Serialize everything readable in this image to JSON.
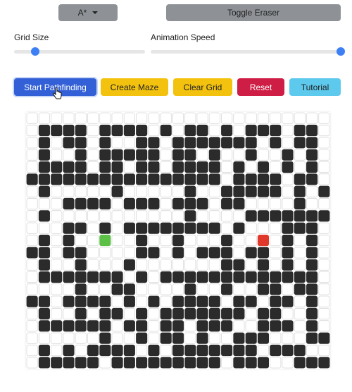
{
  "controls": {
    "algorithm": "A*",
    "toggle_eraser": "Toggle Eraser",
    "grid_size_label": "Grid Size",
    "grid_size_level": 0.16,
    "animation_speed_label": "Animation Speed",
    "animation_speed_level": 1.0
  },
  "actions": {
    "start": "Start Pathfinding",
    "maze": "Create Maze",
    "clear": "Clear Grid",
    "reset": "Reset",
    "tutorial": "Tutorial"
  },
  "grid": {
    "rows": 21,
    "cols": 25,
    "start": [
      10,
      6
    ],
    "end": [
      10,
      19
    ],
    "walls": [
      "0000000000000000000000000",
      "0111101111010110101110110",
      "0101101001101111111010110",
      "0100101111101101001001010",
      "0111101101101111010101010",
      "1111111111111111011110110",
      "0100000100000100111110101",
      "0001111011101110110000100",
      "0100000000000100001111111",
      "0001101011111111010001110",
      "0101000001001000100101010",
      "1101100001101011101101010",
      "0100100010000000110101010",
      "0111111101011111111111110",
      "0000100110000100100110110",
      "1101111010101111011011010",
      "0100101101011111110110010",
      "0111111011011011100111010",
      "0000001001011010011100011",
      "0101011110101111111011100",
      "0111110111111111011100111"
    ]
  },
  "colors": {
    "wall": "#2b2b2b",
    "empty": "#ffffff",
    "start": "#5cbf46",
    "end": "#e0392b",
    "primary": "#3360d6"
  }
}
